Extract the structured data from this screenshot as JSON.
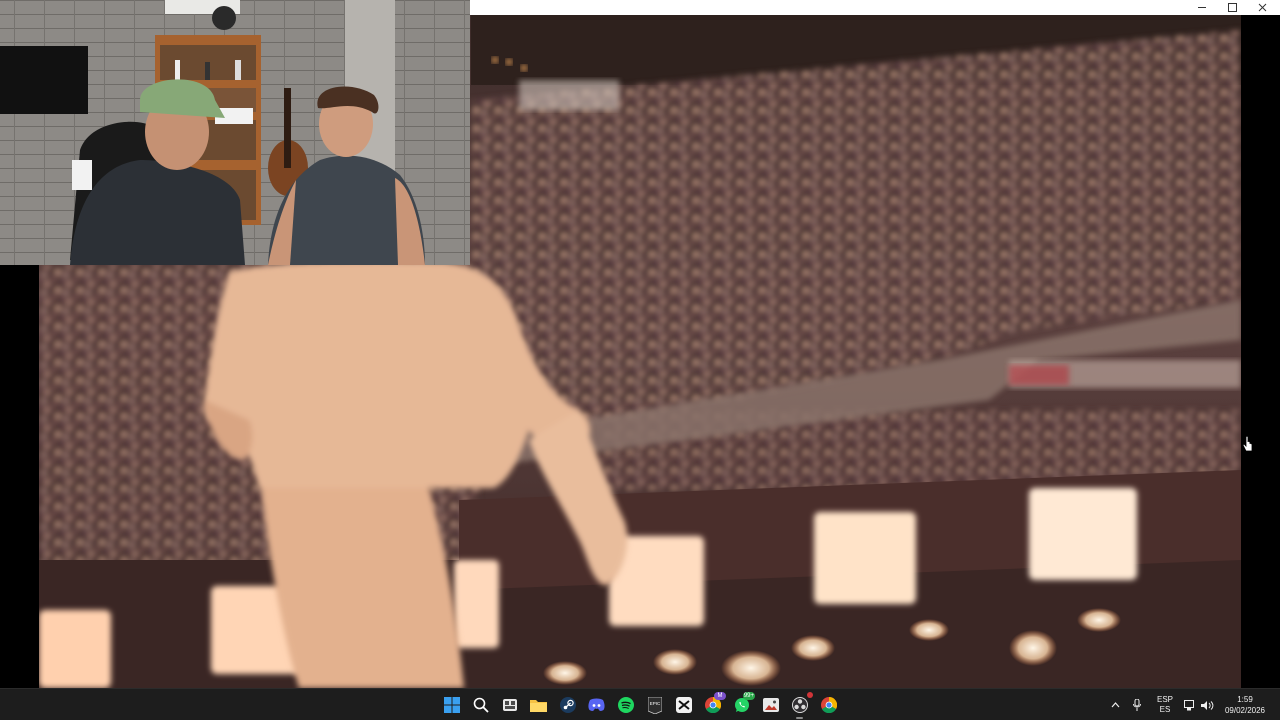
{
  "window": {
    "controls": {
      "minimize": "minimize",
      "maximize": "maximize",
      "close": "close"
    }
  },
  "video": {
    "accent_colors": {
      "crowd": "#5a3c38",
      "lights": "#ffe9d4",
      "outfit": "#e6b896"
    }
  },
  "taskbar": {
    "apps": [
      {
        "name": "windows-start-icon"
      },
      {
        "name": "search-icon"
      },
      {
        "name": "task-view-icon"
      },
      {
        "name": "file-explorer-icon"
      },
      {
        "name": "steam-icon"
      },
      {
        "name": "discord-icon"
      },
      {
        "name": "spotify-icon"
      },
      {
        "name": "epic-games-icon"
      },
      {
        "name": "capcut-icon"
      },
      {
        "name": "chrome-profile-icon",
        "badge": "M"
      },
      {
        "name": "whatsapp-icon",
        "badge": "99+"
      },
      {
        "name": "photos-app-icon"
      },
      {
        "name": "obs-icon",
        "active": true
      },
      {
        "name": "chrome-icon"
      }
    ],
    "tray": {
      "lang_top": "ESP",
      "lang_bottom": "ES",
      "time": "1:59",
      "date": "09/02/2026"
    }
  }
}
